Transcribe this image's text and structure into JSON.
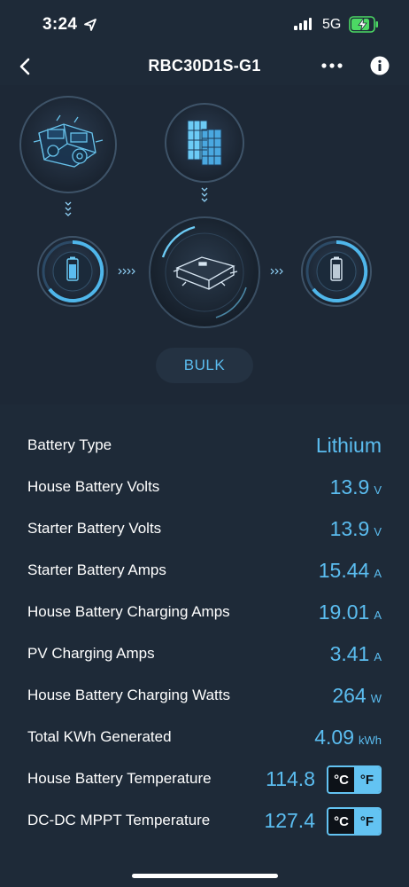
{
  "status_bar": {
    "time": "3:24",
    "network": "5G",
    "icons": [
      "location-arrow-icon",
      "cellular-signal-icon",
      "battery-charging-icon"
    ]
  },
  "nav": {
    "title": "RBC30D1S-G1",
    "icons": [
      "back-chevron-icon",
      "more-dots-icon",
      "info-icon"
    ]
  },
  "diagram": {
    "sources": [
      "engine-icon",
      "solar-panel-icon"
    ],
    "charger_icon": "dc-dc-charger-icon",
    "battery_icons": [
      "house-battery-icon",
      "starter-battery-icon"
    ],
    "charge_stage": "BULK"
  },
  "readings": [
    {
      "label": "Battery Type",
      "value": "Lithium",
      "unit": ""
    },
    {
      "label": "House Battery Volts",
      "value": "13.9",
      "unit": "V"
    },
    {
      "label": "Starter Battery Volts",
      "value": "13.9",
      "unit": "V"
    },
    {
      "label": "Starter Battery Amps",
      "value": "15.44",
      "unit": "A"
    },
    {
      "label": "House Battery Charging Amps",
      "value": "19.01",
      "unit": "A"
    },
    {
      "label": "PV Charging Amps",
      "value": "3.41",
      "unit": "A"
    },
    {
      "label": "House Battery Charging Watts",
      "value": "264",
      "unit": "W"
    },
    {
      "label": "Total KWh Generated",
      "value": "4.09",
      "unit": "kWh"
    }
  ],
  "temperatures": [
    {
      "label": "House Battery Temperature",
      "value": "114.8",
      "celsius": "°C",
      "fahrenheit": "°F",
      "selected": "°F"
    },
    {
      "label": "DC-DC MPPT Temperature",
      "value": "127.4",
      "celsius": "°C",
      "fahrenheit": "°F",
      "selected": "°F"
    }
  ],
  "colors": {
    "accent": "#5bbdf0",
    "background": "#1e2a38",
    "toggle_selected": "#63c3f2"
  }
}
